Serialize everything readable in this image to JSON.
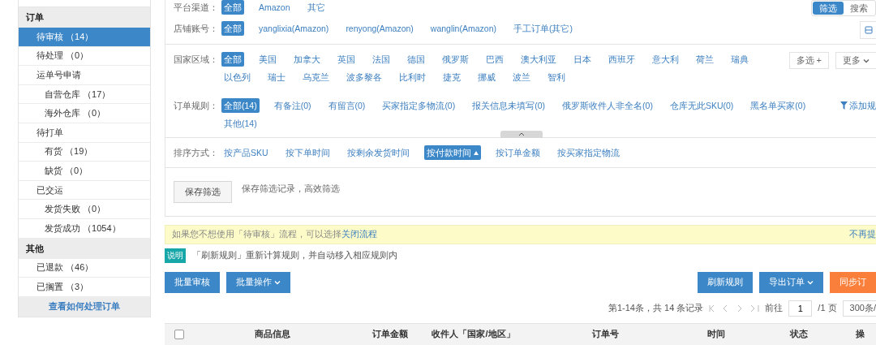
{
  "sidebar": {
    "groups": [
      {
        "title": "订单",
        "items": [
          {
            "label": "待审核 （14）",
            "selected": true
          },
          {
            "label": "待处理 （0）",
            "selected": false
          },
          {
            "label": "运单号申请",
            "selected": false,
            "children": [
              {
                "label": "自营仓库 （17）",
                "selected": false
              },
              {
                "label": "海外仓库 （0）",
                "selected": false
              }
            ]
          },
          {
            "label": "待打单",
            "selected": false,
            "children": [
              {
                "label": "有货 （19）",
                "selected": false
              },
              {
                "label": "缺货 （0）",
                "selected": false
              }
            ]
          },
          {
            "label": "已交运",
            "selected": false,
            "children": [
              {
                "label": "发货失败 （0）",
                "selected": false
              },
              {
                "label": "发货成功 （1054）",
                "selected": false
              }
            ]
          }
        ]
      },
      {
        "title": "其他",
        "items": [
          {
            "label": "已退款 （46）",
            "selected": false
          },
          {
            "label": "已搁置 （3）",
            "selected": false
          }
        ]
      }
    ],
    "help_link": "查看如何处理订单"
  },
  "view_toggle": [
    {
      "label": "筛选",
      "selected": true
    },
    {
      "label": "搜索",
      "selected": false
    }
  ],
  "filters": [
    {
      "label": "平台渠道：",
      "options": [
        {
          "label": "全部",
          "selected": true
        },
        {
          "label": "Amazon",
          "selected": false
        },
        {
          "label": "其它",
          "selected": false
        }
      ]
    },
    {
      "label": "店铺账号：",
      "options": [
        {
          "label": "全部",
          "selected": true
        },
        {
          "label": "yanglixia(Amazon)",
          "selected": false
        },
        {
          "label": "renyong(Amazon)",
          "selected": false
        },
        {
          "label": "wanglin(Amazon)",
          "selected": false
        },
        {
          "label": "手工订单(其它)",
          "selected": false
        }
      ]
    },
    {
      "label": "国家区域：",
      "options": [
        {
          "label": "全部",
          "selected": true
        },
        {
          "label": "美国",
          "selected": false
        },
        {
          "label": "加拿大",
          "selected": false
        },
        {
          "label": "英国",
          "selected": false
        },
        {
          "label": "法国",
          "selected": false
        },
        {
          "label": "德国",
          "selected": false
        },
        {
          "label": "俄罗斯",
          "selected": false
        },
        {
          "label": "巴西",
          "selected": false
        },
        {
          "label": "澳大利亚",
          "selected": false
        },
        {
          "label": "日本",
          "selected": false
        },
        {
          "label": "西班牙",
          "selected": false
        },
        {
          "label": "意大利",
          "selected": false
        },
        {
          "label": "荷兰",
          "selected": false
        },
        {
          "label": "瑞典",
          "selected": false
        },
        {
          "label": "以色列",
          "selected": false
        },
        {
          "label": "瑞士",
          "selected": false
        },
        {
          "label": "乌克兰",
          "selected": false
        },
        {
          "label": "波多黎各",
          "selected": false
        },
        {
          "label": "比利时",
          "selected": false
        },
        {
          "label": "捷克",
          "selected": false
        },
        {
          "label": "挪威",
          "selected": false
        },
        {
          "label": "波兰",
          "selected": false
        },
        {
          "label": "智利",
          "selected": false
        }
      ],
      "multi_button": "多选 +",
      "more_button": "更多"
    },
    {
      "label": "订单规则：",
      "options": [
        {
          "label": "全部(14)",
          "selected": true
        },
        {
          "label": "有备注(0)",
          "selected": false
        },
        {
          "label": "有留言(0)",
          "selected": false
        },
        {
          "label": "买家指定多物流(0)",
          "selected": false
        },
        {
          "label": "报关信息未填写(0)",
          "selected": false
        },
        {
          "label": "俄罗斯收件人非全名(0)",
          "selected": false
        },
        {
          "label": "仓库无此SKU(0)",
          "selected": false
        },
        {
          "label": "黑名单买家(0)",
          "selected": false
        },
        {
          "label": "其他(14)",
          "selected": false
        }
      ],
      "add_rule": "添加规"
    }
  ],
  "sort": {
    "label": "排序方式：",
    "options": [
      {
        "label": "按产品SKU",
        "selected": false
      },
      {
        "label": "按下单时间",
        "selected": false
      },
      {
        "label": "按剩余发货时间",
        "selected": false
      },
      {
        "label": "按付款时间",
        "selected": true
      },
      {
        "label": "按订单金额",
        "selected": false
      },
      {
        "label": "按买家指定物流",
        "selected": false
      }
    ]
  },
  "save_filter": {
    "button": "保存筛选",
    "hint": "保存筛选记录，高效筛选"
  },
  "notice": {
    "text": "如果您不想使用「待审核」流程，可以选择 ",
    "link": "关闭流程",
    "dismiss": "不再提"
  },
  "explain": {
    "badge": "说明",
    "text": "「刷新规则」重新计算规则，并自动移入相应规则内"
  },
  "actions_left": [
    {
      "label": "批量审核",
      "kind": "primary",
      "dropdown": false
    },
    {
      "label": "批量操作",
      "kind": "primary",
      "dropdown": true
    }
  ],
  "actions_right": [
    {
      "label": "刷新规则",
      "kind": "primary",
      "dropdown": false
    },
    {
      "label": "导出订单",
      "kind": "primary",
      "dropdown": true
    },
    {
      "label": "同步订",
      "kind": "warning",
      "dropdown": false
    }
  ],
  "pagination": {
    "summary": "第1-14条，共 14 条记录",
    "goto": "前往",
    "page": "1",
    "total": "/1 页",
    "page_size": "300条/"
  },
  "table": {
    "select_all": {
      "checked": false
    },
    "columns": [
      "商品信息",
      "订单金额",
      "收件人「国家/地区」",
      "订单号",
      "时间",
      "状态",
      "操"
    ]
  }
}
